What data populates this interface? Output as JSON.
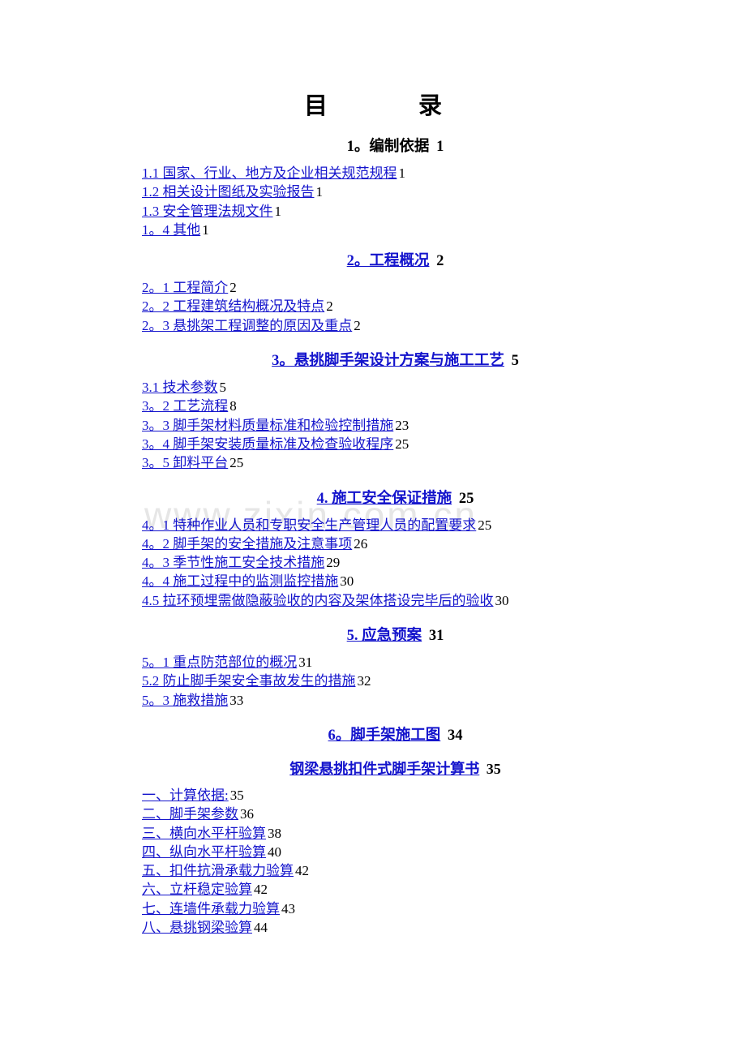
{
  "document": {
    "title": "目　　录",
    "watermark": "www.zixin.com.cn"
  },
  "toc": {
    "sections": [
      {
        "heading": {
          "label": "1。编制依据",
          "page": "1",
          "style": "black",
          "underline": false
        },
        "entries": [
          {
            "label": "1.1 国家、行业、地方及企业相关规范规程",
            "page": "1"
          },
          {
            "label": "1.2 相关设计图纸及实验报告",
            "page": "1"
          },
          {
            "label": "1.3 安全管理法规文件",
            "page": "1"
          },
          {
            "label": "1。4 其他",
            "page": "1"
          }
        ]
      },
      {
        "heading": {
          "label": "2。工程概况",
          "page": "2",
          "style": "blue",
          "underline": true
        },
        "entries": [
          {
            "label": "2。1 工程简介",
            "page": "2"
          },
          {
            "label": "2。2 工程建筑结构概况及特点",
            "page": "2"
          },
          {
            "label": "2。3 悬挑架工程调整的原因及重点",
            "page": "2"
          }
        ]
      },
      {
        "heading": {
          "label": "3。悬挑脚手架设计方案与施工工艺",
          "page": "5",
          "style": "blue",
          "underline": true
        },
        "entries": [
          {
            "label": "3.1 技术参数",
            "page": "5"
          },
          {
            "label": "3。2 工艺流程",
            "page": "8"
          },
          {
            "label": "3。3 脚手架材料质量标准和检验控制措施",
            "page": "23"
          },
          {
            "label": "3。4 脚手架安装质量标准及检查验收程序",
            "page": "25"
          },
          {
            "label": "3。5 卸料平台",
            "page": "25"
          }
        ]
      },
      {
        "heading": {
          "label": "4. 施工安全保证措施",
          "page": "25",
          "style": "blue",
          "underline": true
        },
        "entries": [
          {
            "label": "4。1 特种作业人员和专职安全生产管理人员的配置要求",
            "page": "25"
          },
          {
            "label": "4。2 脚手架的安全措施及注意事项",
            "page": "26"
          },
          {
            "label": "4。3 季节性施工安全技术措施",
            "page": "29"
          },
          {
            "label": "4。4 施工过程中的监测监控措施",
            "page": "30"
          },
          {
            "label": "4.5 拉环预埋需做隐蔽验收的内容及架体搭设完毕后的验收",
            "page": "30"
          }
        ]
      },
      {
        "heading": {
          "label": "5. 应急预案",
          "page": "31",
          "style": "blue",
          "underline": true
        },
        "entries": [
          {
            "label": "5。1 重点防范部位的概况",
            "page": "31"
          },
          {
            "label": "5.2 防止脚手架安全事故发生的措施",
            "page": "32"
          },
          {
            "label": "5。3 施救措施",
            "page": "33"
          }
        ]
      },
      {
        "heading": {
          "label": "6。脚手架施工图",
          "page": "34",
          "style": "blue",
          "underline": true
        },
        "entries": []
      },
      {
        "heading": {
          "label": "钢梁悬挑扣件式脚手架计算书",
          "page": "35",
          "style": "blue",
          "underline": true
        },
        "entries": [
          {
            "label": "一、计算依据:",
            "page": "35"
          },
          {
            "label": "二、脚手架参数",
            "page": "36"
          },
          {
            "label": "三、横向水平杆验算",
            "page": "38"
          },
          {
            "label": "四、纵向水平杆验算",
            "page": "40"
          },
          {
            "label": "五、扣件抗滑承载力验算",
            "page": "42"
          },
          {
            "label": "六、立杆稳定验算",
            "page": "42"
          },
          {
            "label": "七、连墙件承载力验算",
            "page": "43"
          },
          {
            "label": "八、悬挑钢梁验算",
            "page": "44"
          }
        ]
      }
    ]
  }
}
